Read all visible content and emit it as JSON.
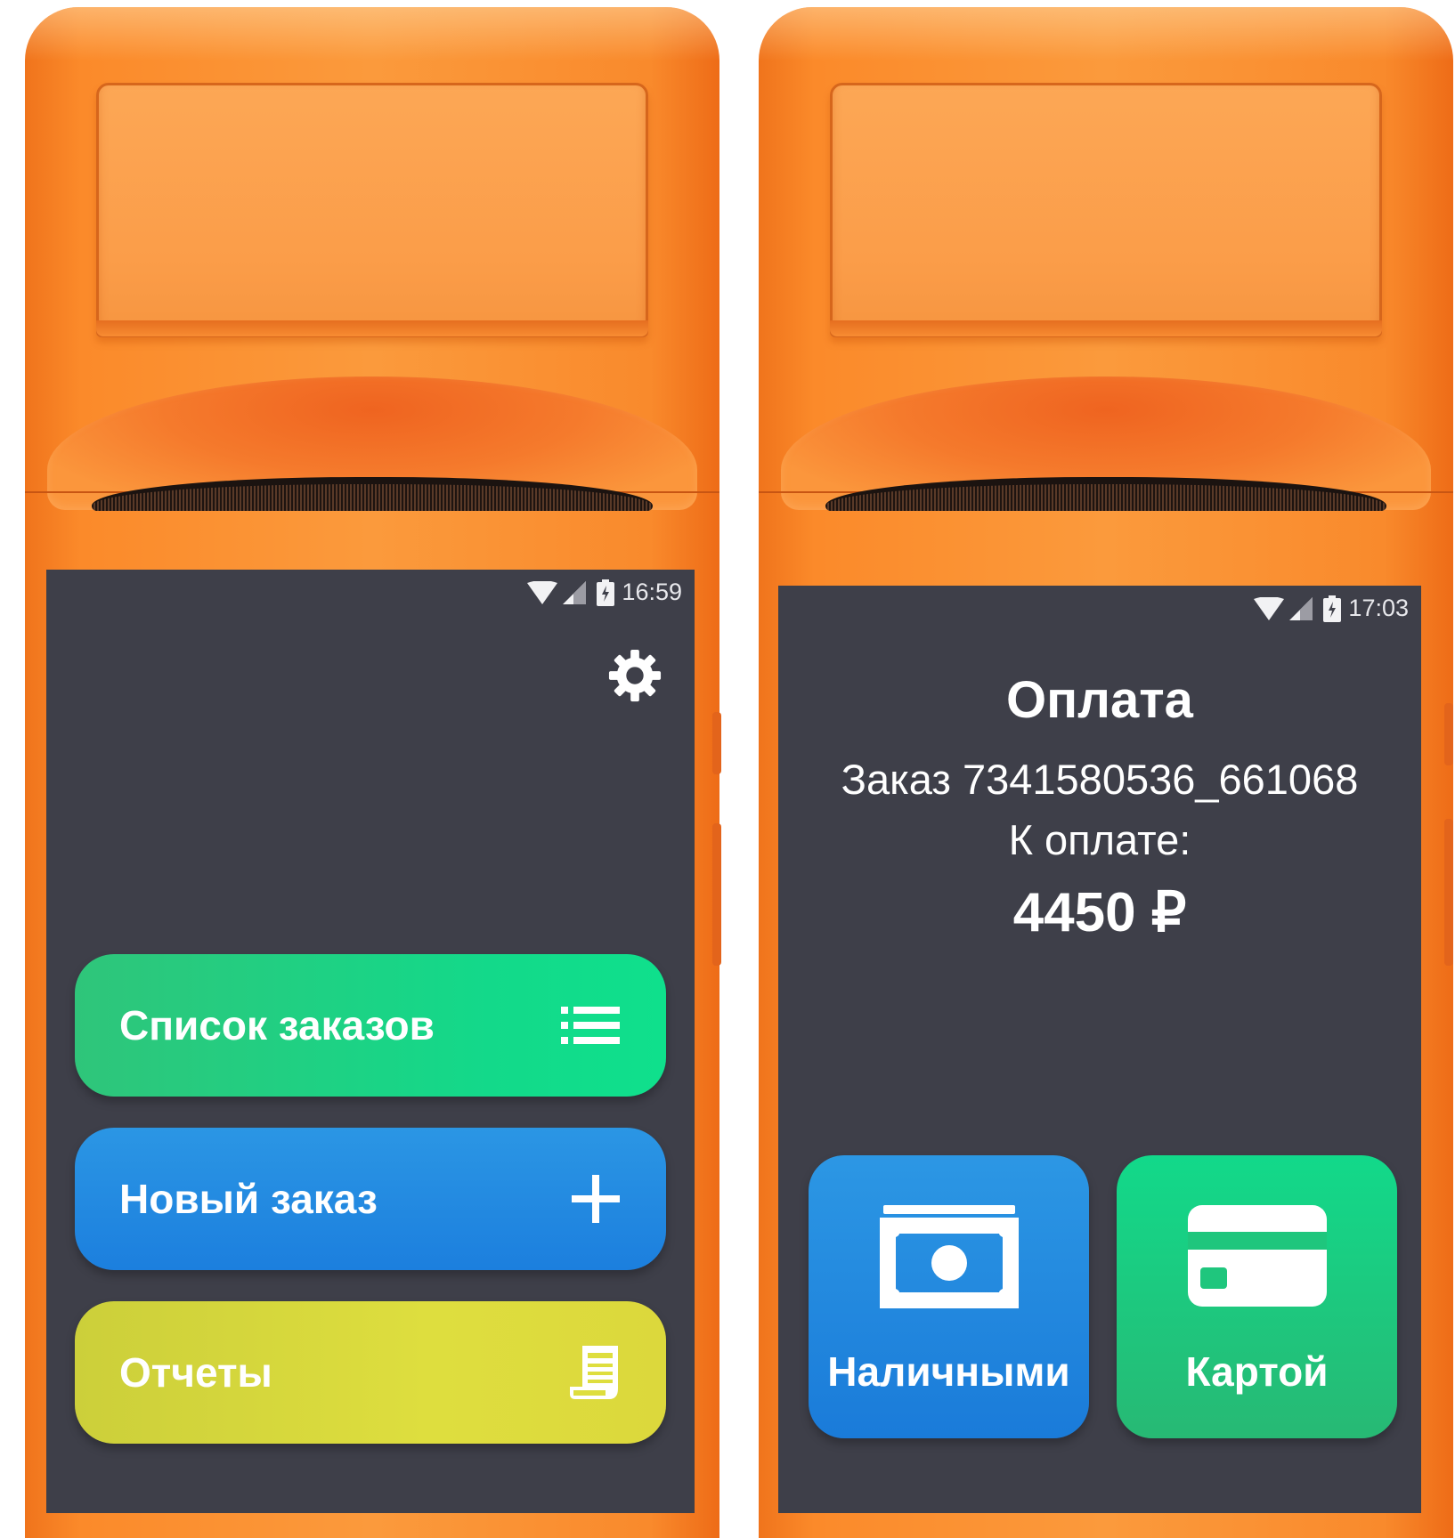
{
  "left_screen": {
    "status": {
      "time": "16:59"
    },
    "settings_icon": "gear-icon",
    "buttons": [
      {
        "label": "Список заказов",
        "icon": "list-icon",
        "color": "#13d98a"
      },
      {
        "label": "Новый заказ",
        "icon": "plus-icon",
        "color": "#1c7fde"
      },
      {
        "label": "Отчеты",
        "icon": "receipt-icon",
        "color": "#dede3e"
      }
    ]
  },
  "right_screen": {
    "status": {
      "time": "17:03"
    },
    "title": "Оплата",
    "order": "Заказ 7341580536_661068",
    "due_label": "К оплате:",
    "amount": "4450 ₽",
    "payment_options": [
      {
        "label": "Наличными",
        "icon": "cash-icon",
        "color": "#1a7bd9"
      },
      {
        "label": "Картой",
        "icon": "card-icon",
        "color": "#12d98a"
      }
    ]
  },
  "device_color": "#fb8a2a",
  "screen_color": "#3e3f49"
}
